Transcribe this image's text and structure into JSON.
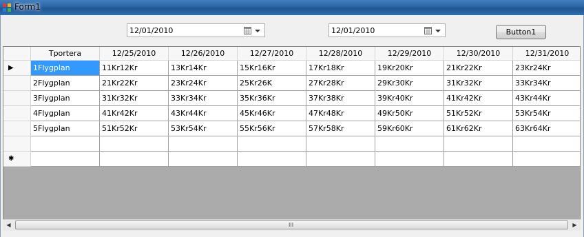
{
  "window": {
    "title": "Form1"
  },
  "pickers": [
    {
      "value": "12/01/2010"
    },
    {
      "value": "12/01/2010"
    }
  ],
  "button1": {
    "label": "Button1"
  },
  "grid": {
    "columns": [
      "Tportera",
      "12/25/2010",
      "12/26/2010",
      "12/27/2010",
      "12/28/2010",
      "12/29/2010",
      "12/30/2010",
      "12/31/2010"
    ],
    "rows": [
      [
        "1Flygplan",
        "11Kr12Kr",
        "13Kr14Kr",
        "15Kr16Kr",
        "17Kr18Kr",
        "19Kr20Kr",
        "21Kr22Kr",
        "23Kr24Kr"
      ],
      [
        "2Flygplan",
        "21Kr22Kr",
        "23Kr24Kr",
        "25Kr26K",
        "27Kr28Kr",
        "29Kr30Kr",
        "31Kr32Kr",
        "33Kr34Kr"
      ],
      [
        "3Flygplan",
        "31Kr32Kr",
        "33Kr34Kr",
        "35Kr36Kr",
        "37Kr38Kr",
        "39Kr40Kr",
        "41Kr42Kr",
        "43Kr44Kr"
      ],
      [
        "4Flygplan",
        "41Kr42Kr",
        "43Kr44Kr",
        "45Kr46Kr",
        "47Kr48Kr",
        "49Kr50Kr",
        "51Kr52Kr",
        "53Kr54Kr"
      ],
      [
        "5Flygplan",
        "51Kr52Kr",
        "53Kr54Kr",
        "55Kr56Kr",
        "57Kr58Kr",
        "59Kr60Kr",
        "61Kr62Kr",
        "63Kr64Kr"
      ]
    ],
    "current_row_indicator": "▶",
    "new_row_indicator": "✱",
    "selected_color": "#3399ff"
  },
  "scrollbar": {
    "left_icon": "arrow-left-icon",
    "right_icon": "arrow-right-icon",
    "left": "◀",
    "right": "▶",
    "grip": "III"
  }
}
